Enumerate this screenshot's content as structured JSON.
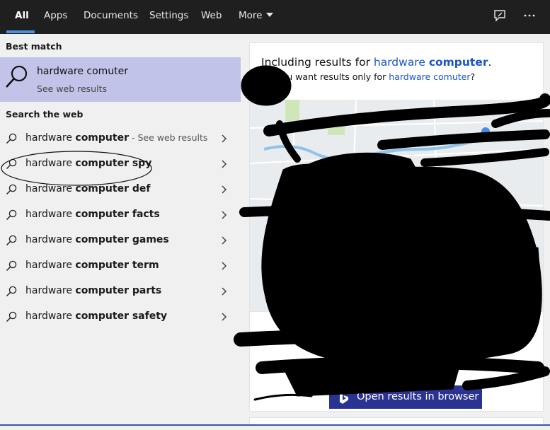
{
  "tabs": [
    {
      "label": "All",
      "active": true
    },
    {
      "label": "Apps"
    },
    {
      "label": "Documents"
    },
    {
      "label": "Settings"
    },
    {
      "label": "Web"
    },
    {
      "label": "More"
    }
  ],
  "top_icons": [
    "feedback-icon",
    "more-options-icon"
  ],
  "left": {
    "best_match_title": "Best match",
    "best_match": {
      "title": "hardware comuter",
      "subtitle": "See web results",
      "icon": "search-icon"
    },
    "search_web_title": "Search the web",
    "suggestions": [
      {
        "prefix": "hardware ",
        "bold": "computer",
        "hint": " - See web results"
      },
      {
        "prefix": "hardware ",
        "bold": "computer spy",
        "hint": ""
      },
      {
        "prefix": "hardware ",
        "bold": "computer def",
        "hint": ""
      },
      {
        "prefix": "hardware ",
        "bold": "computer facts",
        "hint": ""
      },
      {
        "prefix": "hardware ",
        "bold": "computer games",
        "hint": ""
      },
      {
        "prefix": "hardware ",
        "bold": "computer term",
        "hint": ""
      },
      {
        "prefix": "hardware ",
        "bold": "computer parts",
        "hint": ""
      },
      {
        "prefix": "hardware ",
        "bold": "computer safety",
        "hint": ""
      }
    ]
  },
  "right": {
    "including_prefix": "Including results for ",
    "including_link_plain": "hardware ",
    "including_link_bold": "computer",
    "including_suffix": ".",
    "only_prefix": "Do you want results only for ",
    "only_link": "hardware comuter",
    "only_suffix": "?",
    "open_button_label": "Open results in browser",
    "open_button_icon": "bing-logo-icon"
  },
  "colors": {
    "topbar": "#1f1f1f",
    "selected": "#c1c4e8",
    "accent": "#4c8de6",
    "link": "#1a55c8",
    "button": "#2b3392"
  }
}
